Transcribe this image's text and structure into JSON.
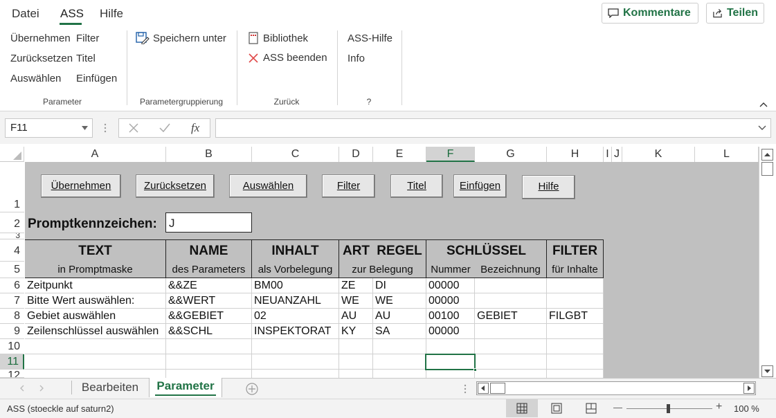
{
  "menu": {
    "datei": "Datei",
    "ass": "ASS",
    "hilfe": "Hilfe"
  },
  "top_buttons": {
    "kommentare": "Kommentare",
    "teilen": "Teilen"
  },
  "ribbon": {
    "parameter_items": [
      "Übernehmen",
      "Zurücksetzen",
      "Auswählen",
      "Filter",
      "Titel",
      "Einfügen"
    ],
    "speichern_unter": "Speichern unter",
    "bibliothek": "Bibliothek",
    "ass_beenden": "ASS beenden",
    "ass_hilfe": "ASS-Hilfe",
    "info": "Info",
    "groups": [
      "Parameter",
      "Parametergruppierung",
      "Zurück",
      "?"
    ]
  },
  "formula_bar": {
    "name_box": "F11",
    "fx": "fx",
    "formula": ""
  },
  "columns": [
    "A",
    "B",
    "C",
    "D",
    "E",
    "F",
    "G",
    "H",
    "I",
    "J",
    "K",
    "L"
  ],
  "rows": [
    "1",
    "2",
    "3",
    "4",
    "5",
    "6",
    "7",
    "8",
    "9",
    "10",
    "11",
    "12"
  ],
  "sheet_buttons": [
    "Übernehmen",
    "Zurücksetzen",
    "Auswählen",
    "Filter",
    "Titel",
    "Einfügen",
    "Hilfe"
  ],
  "prompt": {
    "label": "Promptkennzeichen:",
    "value": "J"
  },
  "table": {
    "headers": [
      {
        "top": "TEXT",
        "bottom": "in Promptmaske"
      },
      {
        "top": "NAME",
        "bottom": "des Parameters"
      },
      {
        "top": "INHALT",
        "bottom": "als Vorbelegung"
      },
      {
        "top": "ART",
        "bottom": ""
      },
      {
        "top": "REGEL",
        "bottom": "zur Belegung"
      },
      {
        "top": "SCHLÜSSEL",
        "bottom_a": "Nummer",
        "bottom_b": "Bezeichnung"
      },
      {
        "top": "FILTER",
        "bottom": "für Inhalte"
      }
    ],
    "rows": [
      [
        "Zeitpunkt",
        "&&ZE",
        "BM00",
        "ZE",
        "DI",
        "00000",
        "",
        ""
      ],
      [
        "Bitte Wert auswählen:",
        "&&WERT",
        "NEUANZAHL",
        "WE",
        "WE",
        "00000",
        "",
        ""
      ],
      [
        "Gebiet auswählen",
        "&&GEBIET",
        "02",
        "AU",
        "AU",
        "00100",
        "GEBIET",
        "FILGBT"
      ],
      [
        "Zeilenschlüssel auswählen",
        "&&SCHL",
        "INSPEKTORAT",
        "KY",
        "SA",
        "00000",
        "",
        ""
      ]
    ]
  },
  "sheets": {
    "bearbeiten": "Bearbeiten",
    "parameter": "Parameter"
  },
  "status": {
    "text": "ASS (stoeckle auf saturn2)",
    "zoom": "100 %",
    "minus": "—",
    "plus": "+"
  },
  "accent": "#217346"
}
